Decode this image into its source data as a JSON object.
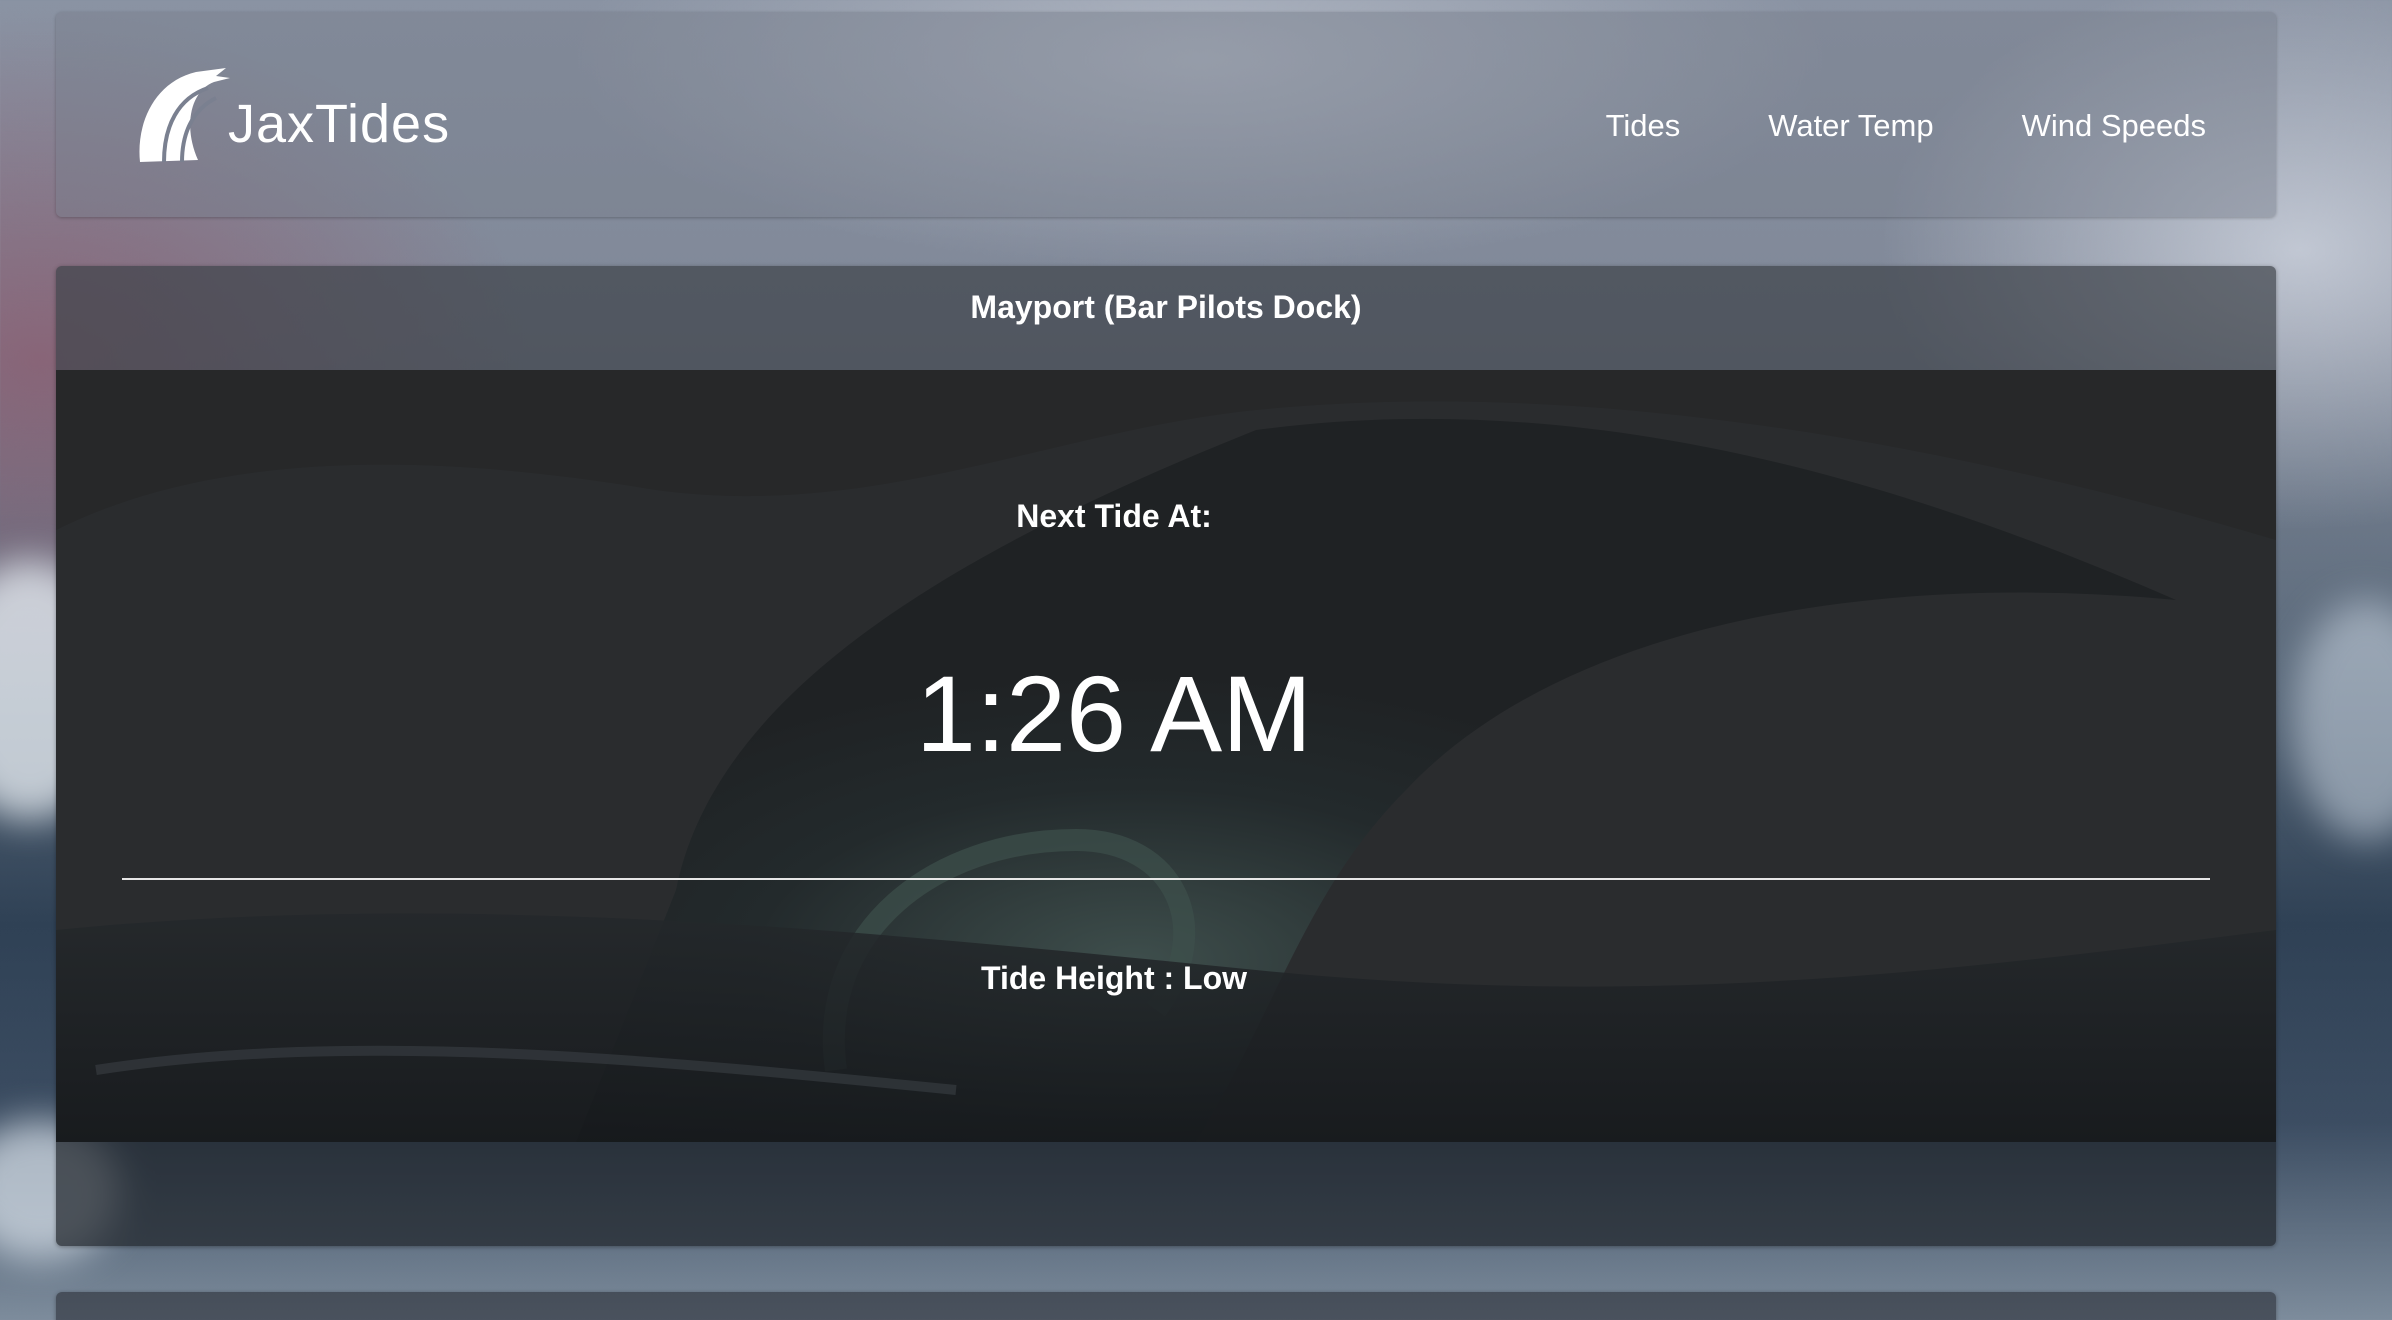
{
  "brand": {
    "name": "JaxTides",
    "logo_icon": "wave-logo-icon"
  },
  "nav": {
    "items": [
      {
        "label": "Tides"
      },
      {
        "label": "Water Temp"
      },
      {
        "label": "Wind Speeds"
      }
    ]
  },
  "tide_card": {
    "station": "Mayport (Bar Pilots Dock)",
    "next_label": "Next Tide At:",
    "next_time": "1:26 AM",
    "height_label": "Tide Height :",
    "height_value": "Low"
  },
  "colors": {
    "text": "#ffffff",
    "card_body": "#262729",
    "divider": "#e6e6e6"
  }
}
